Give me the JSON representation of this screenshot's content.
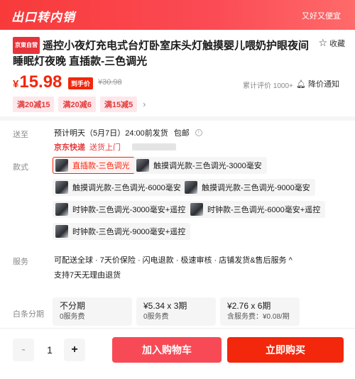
{
  "banner": {
    "title": "出口转内销",
    "slogan": "又好又便宜"
  },
  "product": {
    "brand_tag": "京東自营",
    "title": "遥控小夜灯充电式台灯卧室床头灯触摸婴儿喂奶护眼夜间睡眠灯夜晚 直插款-三色调光",
    "fav_label": "收藏"
  },
  "price": {
    "currency": "¥",
    "value": "15.98",
    "tag": "到手价",
    "original": "¥30.98",
    "review": "累计评价 1000+",
    "notify": "降价通知"
  },
  "coupons": [
    "满20减15",
    "满20减6",
    "满15减5"
  ],
  "coupon_more": "›",
  "shipping": {
    "label": "送至",
    "delivery": "预计明天（5月7日）24:00前发货",
    "free_ship": "包邮",
    "courier": "京东快递",
    "door": "送货上门"
  },
  "style": {
    "label": "款式",
    "options": [
      "直插款-三色调光",
      "触摸调光款-三色调光-3000毫安",
      "触摸调光款-三色调光-6000毫安",
      "触摸调光款-三色调光-9000毫安",
      "时钟款-三色调光-3000毫安+遥控",
      "时钟款-三色调光-6000毫安+遥控",
      "时钟款-三色调光-9000毫安+遥控"
    ],
    "selected_index": 0
  },
  "service": {
    "label": "服务",
    "line1": "可配送全球 · 7天价保险 · 闪电退款 · 极速审核 · 店铺发货&售后服务 ^",
    "line2": "支持7天无理由退货"
  },
  "installment": {
    "label": "白条分期",
    "options": [
      {
        "main": "不分期",
        "sub": "0服务费"
      },
      {
        "main": "¥5.34 x 3期",
        "sub": "0服务费"
      },
      {
        "main": "¥2.76 x 6期",
        "sub": "含服务费：¥0.08/期"
      }
    ]
  },
  "bottom": {
    "minus": "-",
    "quantity": "1",
    "plus": "+",
    "add_cart": "加入购物车",
    "buy_now": "立即购买"
  },
  "colors": {
    "accent": "#f2270c",
    "banner": "#f83a3a",
    "cart": "#f74a56"
  },
  "icons": {
    "fav": "star-outline-icon",
    "notify": "bell-icon",
    "info": "info-circle-icon"
  }
}
